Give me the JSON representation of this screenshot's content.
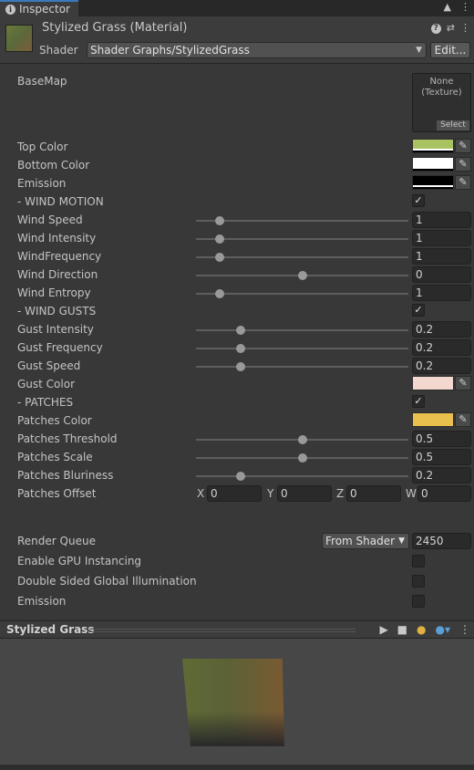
{
  "tab": {
    "label": "Inspector"
  },
  "header": {
    "title": "Stylized Grass (Material)",
    "shader_label": "Shader",
    "shader_value": "Shader Graphs/StylizedGrass",
    "edit_label": "Edit..."
  },
  "basemap": {
    "label": "BaseMap",
    "none_text": "None\n(Texture)",
    "select_label": "Select"
  },
  "properties": {
    "top_color": {
      "label": "Top Color",
      "color": "#a9c363"
    },
    "bottom_color": {
      "label": "Bottom Color",
      "color": "#ffffff"
    },
    "emission_color": {
      "label": "Emission",
      "color": "#000000"
    },
    "wind_motion": {
      "label": "- WIND MOTION",
      "checked": true
    },
    "wind_speed": {
      "label": "Wind Speed",
      "value": "1",
      "slider": 0.11
    },
    "wind_intensity": {
      "label": "Wind Intensity",
      "value": "1",
      "slider": 0.11
    },
    "wind_frequency": {
      "label": "WindFrequency",
      "value": "1",
      "slider": 0.11
    },
    "wind_direction": {
      "label": "Wind Direction",
      "value": "0",
      "slider": 0.5
    },
    "wind_entropy": {
      "label": "Wind Entropy",
      "value": "1",
      "slider": 0.11
    },
    "wind_gusts": {
      "label": "- WIND GUSTS",
      "checked": true
    },
    "gust_intensity": {
      "label": "Gust Intensity",
      "value": "0.2",
      "slider": 0.21
    },
    "gust_frequency": {
      "label": "Gust Frequency",
      "value": "0.2",
      "slider": 0.21
    },
    "gust_speed": {
      "label": "Gust Speed",
      "value": "0.2",
      "slider": 0.21
    },
    "gust_color": {
      "label": "Gust Color",
      "color": "#f3d8cf"
    },
    "patches": {
      "label": "- PATCHES",
      "checked": true
    },
    "patches_color": {
      "label": "Patches Color",
      "color": "#e9c04e"
    },
    "patches_threshold": {
      "label": "Patches Threshold",
      "value": "0.5",
      "slider": 0.5
    },
    "patches_scale": {
      "label": "Patches Scale",
      "value": "0.5",
      "slider": 0.5
    },
    "patches_bluriness": {
      "label": "Patches Bluriness",
      "value": "0.2",
      "slider": 0.21
    },
    "patches_offset": {
      "label": "Patches Offset",
      "x_label": "X",
      "x": "0",
      "y_label": "Y",
      "y": "0",
      "z_label": "Z",
      "z": "0",
      "w_label": "W",
      "w": "0"
    }
  },
  "advanced": {
    "render_queue_label": "Render Queue",
    "render_queue_mode": "From Shader",
    "render_queue_value": "2450",
    "gpu_instancing_label": "Enable GPU Instancing",
    "double_sided_gi_label": "Double Sided Global Illumination",
    "emission_label": "Emission"
  },
  "preview": {
    "title": "Stylized Grass"
  }
}
